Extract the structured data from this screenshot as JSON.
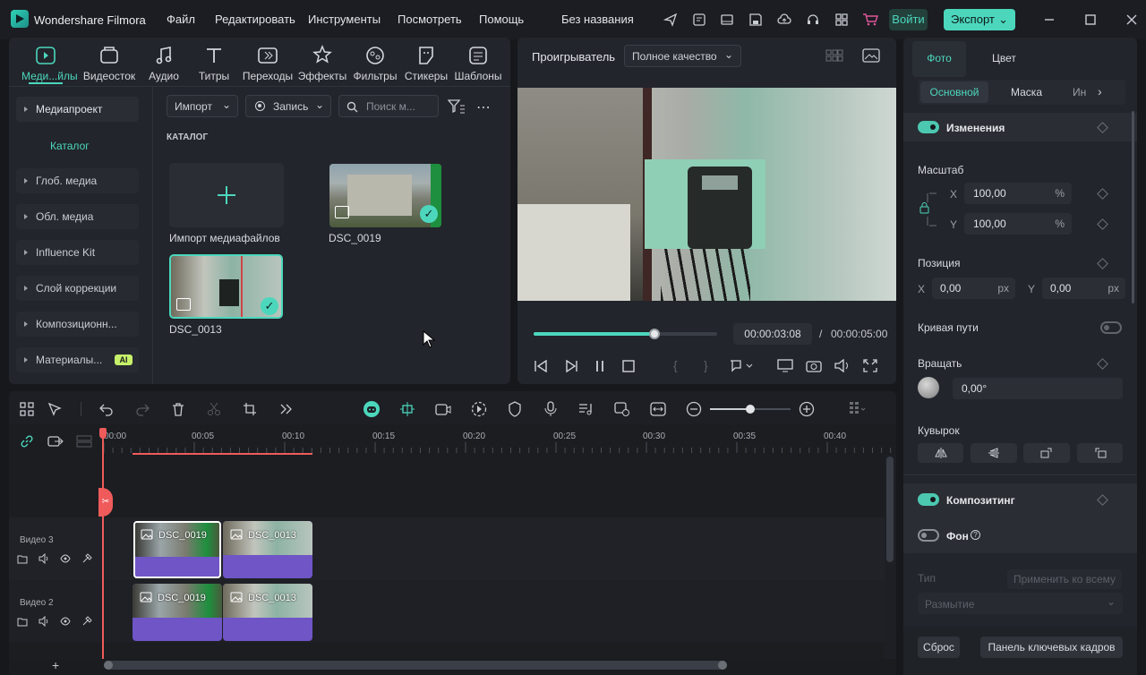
{
  "app": {
    "title": "Wondershare Filmora",
    "project_name": "Без названия"
  },
  "menu": [
    "Файл",
    "Редактировать",
    "Инструменты",
    "Посмотреть",
    "Помощь"
  ],
  "header": {
    "login": "Войти",
    "export": "Экспорт"
  },
  "media_tabs": [
    {
      "label": "Меди...йлы",
      "icon": "media-icon"
    },
    {
      "label": "Видеосток",
      "icon": "stock-icon"
    },
    {
      "label": "Аудио",
      "icon": "music-icon"
    },
    {
      "label": "Титры",
      "icon": "title-icon"
    },
    {
      "label": "Переходы",
      "icon": "transition-icon"
    },
    {
      "label": "Эффекты",
      "icon": "effects-icon"
    },
    {
      "label": "Фильтры",
      "icon": "filter-icon"
    },
    {
      "label": "Стикеры",
      "icon": "sticker-icon"
    },
    {
      "label": "Шаблоны",
      "icon": "template-icon"
    }
  ],
  "sidebar": {
    "project": "Медиапроект",
    "catalog": "Каталог",
    "items": [
      "Глоб. медиа",
      "Обл. медиа",
      "Influence Kit",
      "Слой коррекции",
      "Композиционн...",
      "Материалы..."
    ],
    "ai_badge": "AI"
  },
  "media_toolbar": {
    "import": "Импорт",
    "record": "Запись",
    "search_placeholder": "Поиск м..."
  },
  "media": {
    "section": "КАТАЛОГ",
    "import_label": "Импорт медиафайлов",
    "items": [
      "DSC_0019",
      "DSC_0013"
    ]
  },
  "player": {
    "title": "Проигрыватель",
    "quality": "Полное качество",
    "current_time": "00:00:03:08",
    "separator": "/",
    "total_time": "00:00:05:00",
    "progress": 0.66
  },
  "timeline": {
    "ruler": [
      "00:00",
      "00:05",
      "00:10",
      "00:15",
      "00:20",
      "00:25",
      "00:30",
      "00:35",
      "00:40"
    ],
    "tracks": [
      {
        "name": "Видео 3",
        "clips": [
          "DSC_0019",
          "DSC_0013"
        ]
      },
      {
        "name": "Видео 2",
        "clips": [
          "DSC_0019",
          "DSC_0013"
        ]
      }
    ],
    "add_track": "+"
  },
  "properties": {
    "tabs": [
      "Фото",
      "Цвет"
    ],
    "subtabs": [
      "Основной",
      "Маска",
      "Ин"
    ],
    "changes": "Изменения",
    "scale": "Масштаб",
    "scale_x_label": "X",
    "scale_y_label": "Y",
    "scale_x": "100,00",
    "scale_y": "100,00",
    "percent": "%",
    "position": "Позиция",
    "pos_x_label": "X",
    "pos_y_label": "Y",
    "pos_x": "0,00",
    "pos_y": "0,00",
    "px": "px",
    "path_curve": "Кривая пути",
    "rotate": "Вращать",
    "rotate_value": "0,00°",
    "flip": "Кувырок",
    "compositing": "Композитинг",
    "background": "Фон",
    "type_label": "Тип",
    "apply_all": "Применить ко всему",
    "blur": "Размытие",
    "reset": "Сброс",
    "keyframe_panel": "Панель ключевых кадров"
  },
  "colors": {
    "accent": "#4cc8b0",
    "clip": "#6f55c6",
    "playhead": "#ef5b5b"
  }
}
